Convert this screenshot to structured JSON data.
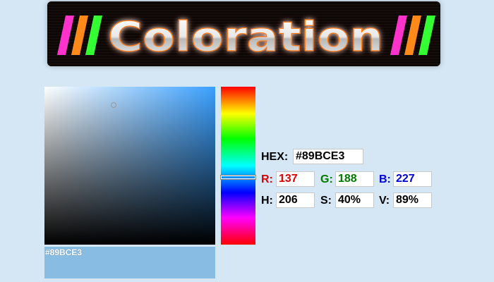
{
  "logo": {
    "text": "Coloration",
    "stripe_colors": [
      "#ff33cc",
      "#ff8a1a",
      "#33ff33"
    ]
  },
  "picker": {
    "current_hex": "#89BCE3",
    "hue_color": "#3aa0ff"
  },
  "preview": {
    "label": "#89BCE3",
    "color": "#89BCE3"
  },
  "fields": {
    "hex": {
      "label": "HEX:",
      "value": "#89BCE3"
    },
    "r": {
      "label": "R:",
      "value": "137",
      "color": "#dd0000"
    },
    "g": {
      "label": "G:",
      "value": "188",
      "color": "#007a00"
    },
    "b": {
      "label": "B:",
      "value": "227",
      "color": "#0000dd"
    },
    "h": {
      "label": "H:",
      "value": "206"
    },
    "s": {
      "label": "S:",
      "value": "40%"
    },
    "v": {
      "label": "V:",
      "value": "89%"
    }
  }
}
